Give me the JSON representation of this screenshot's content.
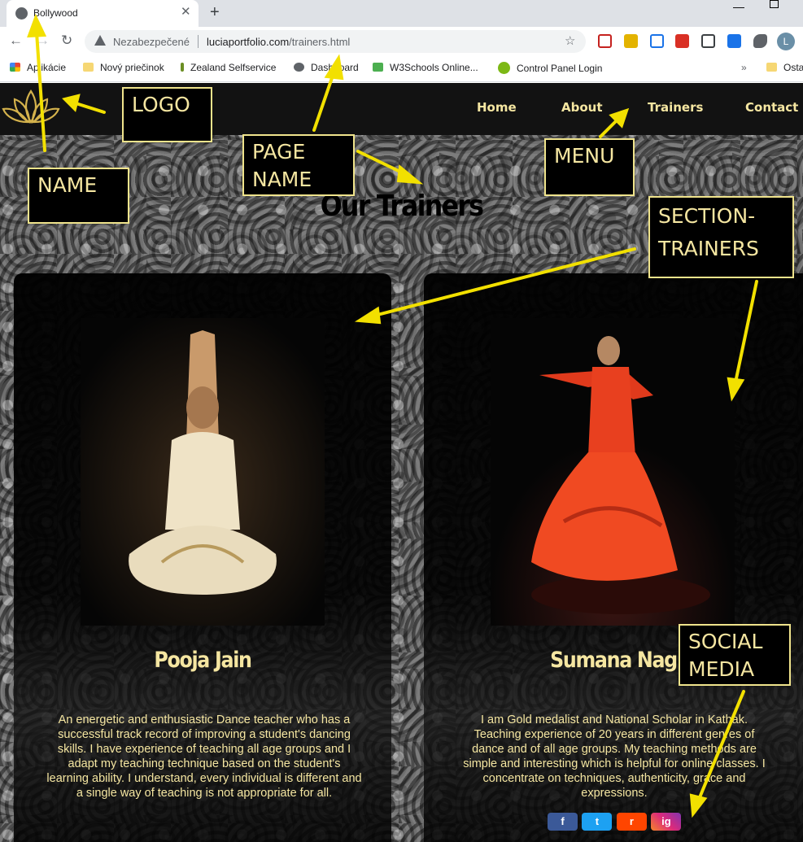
{
  "browser": {
    "tab_title": "Bollywood",
    "insecure_label": "Nezabezpečené",
    "url_domain": "luciaportfolio.com",
    "url_path": "/trainers.html",
    "profile_initial": "L",
    "bookmarks": [
      "Aplikácie",
      "Nový priečinok",
      "Zealand Selfservice",
      "Dashboard",
      "W3Schools Online...",
      "Control Panel Login",
      "Ostat"
    ],
    "bookmarks_overflow": "»"
  },
  "site": {
    "menu": [
      "Home",
      "About",
      "Trainers",
      "Contact"
    ],
    "page_title": "Our Trainers",
    "trainers": [
      {
        "name": "Pooja Jain",
        "bio": "An energetic and enthusiastic Dance teacher who has a successful track record of improving a student's dancing skills. I have experience of teaching all age groups and I adapt my teaching technique based on the student's learning ability. I understand, every individual is different and a single way of teaching is not appropriate for all."
      },
      {
        "name": "Sumana Nag",
        "bio": "I am Gold medalist and National Scholar in Kathak. Teaching experience of 20 years in different genres of dance and of all age groups. My teaching methods are simple and interesting which is helpful for online classes. I concentrate on techniques, authenticity, grace and expressions."
      }
    ],
    "social": [
      "f",
      "t",
      "r",
      "ig"
    ],
    "social_icons": [
      "facebook-icon",
      "twitter-icon",
      "reddit-icon",
      "instagram-icon"
    ]
  },
  "annotations": {
    "logo": "LOGO",
    "name": "NAME",
    "page_name_1": "PAGE",
    "page_name_2": "NAME",
    "menu": "MENU",
    "section_1": "SECTION-",
    "section_2": "TRAINERS",
    "social_1": "SOCIAL",
    "social_2": "MEDIA"
  },
  "colors": {
    "accent": "#f5e6a1",
    "annotation_arrow": "#f2e000",
    "header_bg": "#121212"
  }
}
